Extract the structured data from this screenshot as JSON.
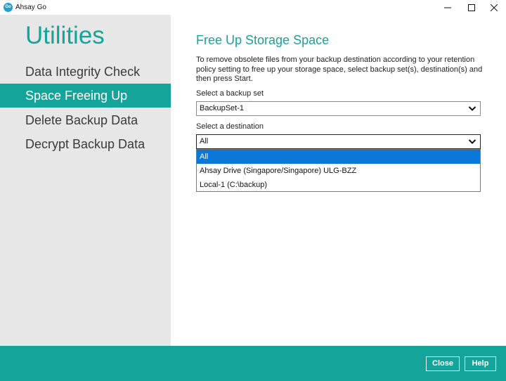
{
  "window": {
    "logo_text": "Go",
    "title": "Ahsay Go"
  },
  "sidebar": {
    "title": "Utilities",
    "items": [
      {
        "label": "Data Integrity Check",
        "active": false
      },
      {
        "label": "Space Freeing Up",
        "active": true
      },
      {
        "label": "Delete Backup Data",
        "active": false
      },
      {
        "label": "Decrypt Backup Data",
        "active": false
      }
    ]
  },
  "main": {
    "title": "Free Up Storage Space",
    "description": "To remove obsolete files from your backup destination according to your retention policy setting to free up your storage space, select backup set(s), destination(s) and then press Start.",
    "backup_set": {
      "label": "Select a backup set",
      "value": "BackupSet-1"
    },
    "destination": {
      "label": "Select a destination",
      "value": "All",
      "options": [
        {
          "label": "All",
          "selected": true
        },
        {
          "label": "Ahsay Drive (Singapore/Singapore) ULG-BZZ",
          "selected": false
        },
        {
          "label": "Local-1 (C:\\backup)",
          "selected": false
        }
      ]
    }
  },
  "footer": {
    "close_label": "Close",
    "help_label": "Help"
  },
  "colors": {
    "accent": "#15a49a",
    "sidebar_bg": "#e7e7e7",
    "selection": "#0b78d7"
  },
  "icons": {
    "minimize": "minimize-icon",
    "maximize": "maximize-icon",
    "close": "close-icon",
    "chevron": "chevron-down-icon"
  }
}
